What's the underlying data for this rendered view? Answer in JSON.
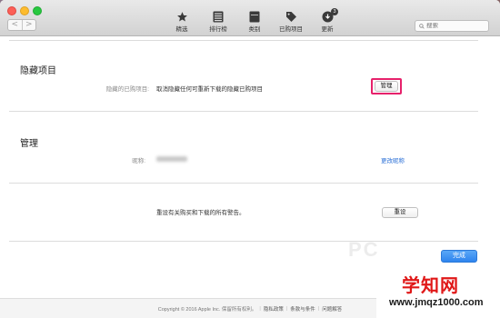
{
  "toolbar": {
    "nav_back": "<",
    "nav_forward": ">",
    "tabs": [
      {
        "label": "精选",
        "icon": "star-icon"
      },
      {
        "label": "排行榜",
        "icon": "list-icon"
      },
      {
        "label": "类别",
        "icon": "book-icon"
      },
      {
        "label": "已购项目",
        "icon": "tag-icon"
      },
      {
        "label": "更新",
        "icon": "update-icon",
        "badge": "3"
      }
    ],
    "search_placeholder": "搜索"
  },
  "hidden_items": {
    "title": "隐藏项目",
    "field_label": "隐藏的已购项目:",
    "field_text": "取消隐藏任何可重新下载的隐藏已购项目",
    "manage_button": "管理"
  },
  "manage": {
    "title": "管理",
    "nickname_label": "昵称:",
    "change_nickname_link": "更改昵称"
  },
  "reset": {
    "text": "重设有关购买和下载的所有警告。",
    "button": "重设"
  },
  "done_button": "完成",
  "footer": {
    "copyright": "Copyright © 2016 Apple Inc. 保留所有权利。",
    "links": [
      "隐私政策",
      "条款与条件",
      "问题解答"
    ]
  },
  "watermark": {
    "pc": "PC",
    "brand": "学知网",
    "url": "www.jmqz1000.com"
  },
  "colors": {
    "accent": "#2a6fd6",
    "highlight": "#e6216b",
    "watermark_red": "#e01818"
  }
}
